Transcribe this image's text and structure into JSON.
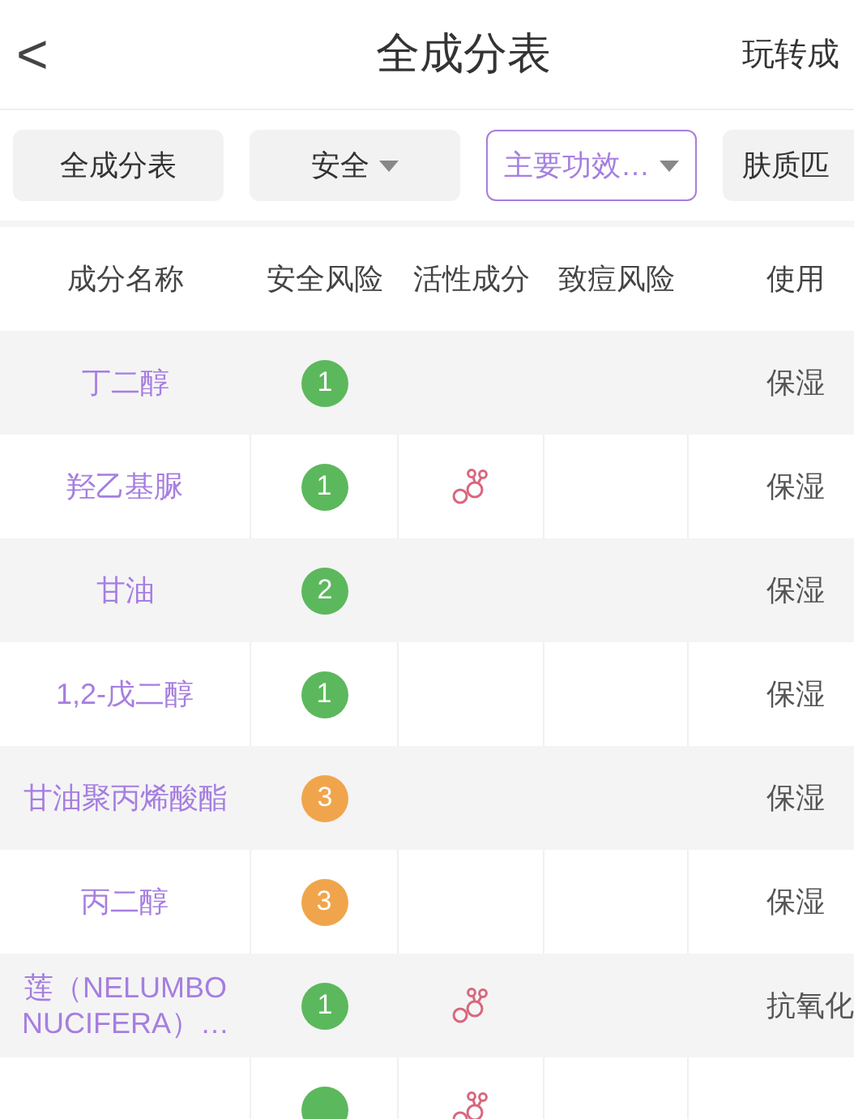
{
  "nav": {
    "back": "<",
    "title": "全成分表",
    "right_link": "玩转成"
  },
  "filters": [
    {
      "label": "全成分表",
      "dropdown": false,
      "selected": false
    },
    {
      "label": "安全",
      "dropdown": true,
      "selected": false
    },
    {
      "label": "主要功效…",
      "dropdown": true,
      "selected": true
    },
    {
      "label": "肤质匹",
      "dropdown": false,
      "selected": false
    }
  ],
  "table": {
    "columns": [
      "成分名称",
      "安全风险",
      "活性成分",
      "致痘风险",
      "使用"
    ],
    "rows": [
      {
        "name": "丁二醇",
        "risk": {
          "text": "1",
          "color": "#5cb85c"
        },
        "active": false,
        "usage": "保湿"
      },
      {
        "name": "羟乙基脲",
        "risk": {
          "text": "1",
          "color": "#5cb85c"
        },
        "active": true,
        "usage": "保湿"
      },
      {
        "name": "甘油",
        "risk": {
          "text": "2",
          "color": "#5cb85c"
        },
        "active": false,
        "usage": "保湿"
      },
      {
        "name": "1,2-戊二醇",
        "risk": {
          "text": "1",
          "color": "#5cb85c"
        },
        "active": false,
        "usage": "保湿"
      },
      {
        "name": "甘油聚丙烯酸酯",
        "risk": {
          "text": "3",
          "color": "#f0a54c"
        },
        "active": false,
        "usage": "保湿"
      },
      {
        "name": "丙二醇",
        "risk": {
          "text": "3",
          "color": "#f0a54c"
        },
        "active": false,
        "usage": "保湿"
      },
      {
        "name": "莲（NELUMBO NUCIFERA）…",
        "risk": {
          "text": "1",
          "color": "#5cb85c"
        },
        "active": true,
        "usage": "抗氧化"
      },
      {
        "risk": {
          "color": "#5cb85c"
        },
        "active": true
      }
    ]
  }
}
